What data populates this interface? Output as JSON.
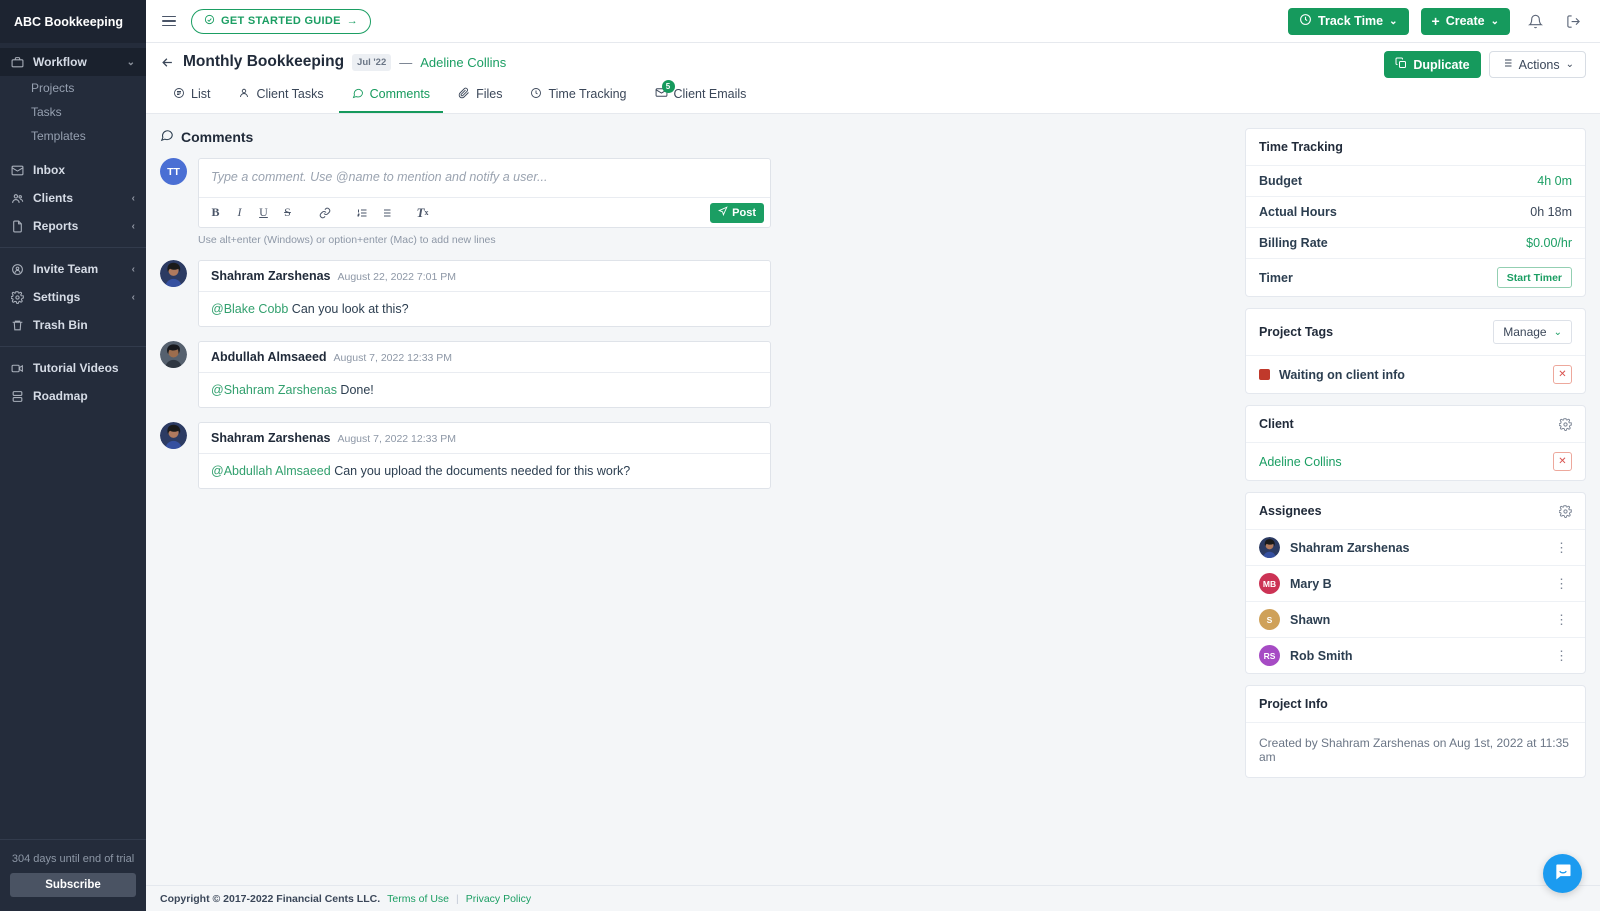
{
  "sidebar": {
    "brand": "ABC Bookkeeping",
    "items": [
      {
        "label": "Workflow",
        "icon": "briefcase-icon",
        "chevron": "⌄",
        "active": true
      },
      {
        "label": "Projects",
        "sub": true
      },
      {
        "label": "Tasks",
        "sub": true
      },
      {
        "label": "Templates",
        "sub": true
      },
      {
        "label": "Inbox",
        "icon": "envelope-icon",
        "chevron": ""
      },
      {
        "label": "Clients",
        "icon": "users-icon",
        "chevron": "‹"
      },
      {
        "label": "Reports",
        "icon": "document-icon",
        "chevron": "‹"
      },
      {
        "label": "Invite Team",
        "icon": "person-add-icon",
        "chevron": "‹"
      },
      {
        "label": "Settings",
        "icon": "gear-icon",
        "chevron": "‹"
      },
      {
        "label": "Trash Bin",
        "icon": "trash-icon",
        "chevron": ""
      },
      {
        "label": "Tutorial Videos",
        "icon": "video-icon",
        "chevron": ""
      },
      {
        "label": "Roadmap",
        "icon": "roadmap-icon",
        "chevron": ""
      }
    ],
    "trial_text": "304 days until end of trial",
    "subscribe_label": "Subscribe"
  },
  "topbar": {
    "get_started_label": "GET STARTED GUIDE",
    "get_started_arrow": "→",
    "track_time_label": "Track Time",
    "create_label": "Create",
    "chevron": "⌄",
    "plus": "+"
  },
  "project": {
    "title": "Monthly Bookkeeping",
    "period_badge": "Jul '22",
    "dash": "—",
    "client": "Adeline Collins",
    "duplicate_label": "Duplicate",
    "actions_label": "Actions",
    "tabs": [
      {
        "label": "List",
        "icon": "list-icon",
        "active": false,
        "badge": ""
      },
      {
        "label": "Client Tasks",
        "icon": "person-icon",
        "active": false,
        "badge": ""
      },
      {
        "label": "Comments",
        "icon": "comment-icon",
        "active": true,
        "badge": ""
      },
      {
        "label": "Files",
        "icon": "paperclip-icon",
        "active": false,
        "badge": ""
      },
      {
        "label": "Time Tracking",
        "icon": "clock-icon",
        "active": false,
        "badge": ""
      },
      {
        "label": "Client Emails",
        "icon": "mail-icon",
        "active": false,
        "badge": "5"
      }
    ]
  },
  "comments": {
    "heading": "Comments",
    "composer": {
      "avatar_initials": "TT",
      "placeholder": "Type a comment. Use @name to mention and notify a user...",
      "post_label": "Post",
      "hint": "Use alt+enter (Windows) or option+enter (Mac) to add new lines",
      "toolbar": [
        "B",
        "I",
        "U",
        "S",
        "link-icon",
        "ordered-list-icon",
        "bullet-list-icon",
        "clear-format-icon"
      ]
    },
    "items": [
      {
        "author": "Shahram Zarshenas",
        "date": "August 22, 2022 7:01 PM",
        "mention": "@Blake Cobb",
        "text": " Can you look at this?",
        "avatar": "photo-1"
      },
      {
        "author": "Abdullah Almsaeed",
        "date": "August 7, 2022 12:33 PM",
        "mention": "@Shahram Zarshenas",
        "text": " Done!",
        "avatar": "photo-2"
      },
      {
        "author": "Shahram Zarshenas",
        "date": "August 7, 2022 12:33 PM",
        "mention": "@Abdullah Almsaeed",
        "text": " Can you upload the documents needed for this work?",
        "avatar": "photo-1"
      }
    ]
  },
  "time_tracking": {
    "heading": "Time Tracking",
    "budget_label": "Budget",
    "budget_value": "4h 0m",
    "actual_label": "Actual Hours",
    "actual_value": "0h 18m",
    "rate_label": "Billing Rate",
    "rate_value": "$0.00/hr",
    "timer_label": "Timer",
    "start_timer_label": "Start Timer"
  },
  "project_tags": {
    "heading": "Project Tags",
    "manage_label": "Manage",
    "chevron": "⌄",
    "tags": [
      {
        "name": "Waiting on client info",
        "color": "#c0392b",
        "remove": "✕"
      }
    ]
  },
  "client_card": {
    "heading": "Client",
    "name": "Adeline Collins",
    "remove": "✕"
  },
  "assignees": {
    "heading": "Assignees",
    "items": [
      {
        "name": "Shahram Zarshenas",
        "initials": "",
        "color": "",
        "avatar": "photo-1",
        "menu": "⋮"
      },
      {
        "name": "Mary B",
        "initials": "MB",
        "color": "#cc3355",
        "avatar": "",
        "menu": "⋮"
      },
      {
        "name": "Shawn",
        "initials": "S",
        "color": "#cfa159",
        "avatar": "",
        "menu": "⋮"
      },
      {
        "name": "Rob Smith",
        "initials": "RS",
        "color": "#a64bc4",
        "avatar": "",
        "menu": "⋮"
      }
    ]
  },
  "project_info": {
    "heading": "Project Info",
    "text": "Created by Shahram Zarshenas on Aug 1st, 2022 at 11:35 am"
  },
  "footer": {
    "copyright": "Copyright © 2017-2022 Financial Cents LLC.",
    "terms": "Terms of Use",
    "separator": "|",
    "privacy": "Privacy Policy"
  },
  "colors": {
    "brand_green": "#169a5d",
    "sidebar_bg": "#242c3b",
    "chat_blue": "#1b9bf0",
    "tag_red": "#c0392b"
  }
}
